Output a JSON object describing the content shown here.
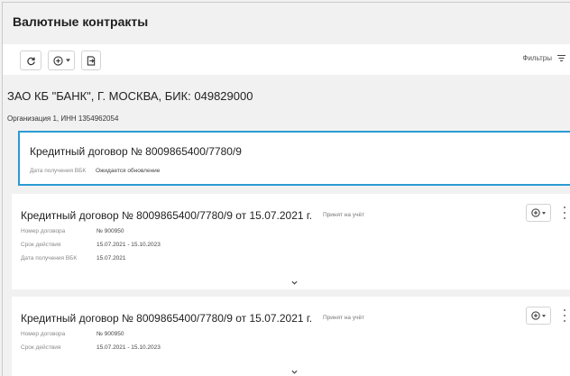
{
  "page": {
    "title": "Валютные контракты"
  },
  "toolbar": {
    "filters_label": "Фильтры"
  },
  "bank": {
    "title": "ЗАО КБ \"БАНК\", Г. МОСКВА, БИК: 049829000"
  },
  "organization": {
    "label": "Организация 1, ИНН 1354962054"
  },
  "cards": [
    {
      "title": "Кредитный договор № 8009865400/7780/9",
      "fields": [
        {
          "key": "Дата получения ВБК",
          "value": "Ожидается обновление"
        }
      ]
    },
    {
      "title": "Кредитный договор № 8009865400/7780/9 от 15.07.2021 г.",
      "status": "Принят на учёт",
      "fields": [
        {
          "key": "Номер договора",
          "value": "№ 900950"
        },
        {
          "key": "Срок действия",
          "value": "15.07.2021 - 15.10.2023"
        },
        {
          "key": "Дата получения ВБК",
          "value": "15.07.2021"
        }
      ]
    },
    {
      "title": "Кредитный договор № 8009865400/7780/9 от 15.07.2021 г.",
      "status": "Принят на учёт",
      "fields": [
        {
          "key": "Номер договора",
          "value": "№ 900950"
        },
        {
          "key": "Срок действия",
          "value": "15.07.2021 - 15.10.2023"
        }
      ]
    }
  ],
  "icons": {
    "refresh": "refresh-icon",
    "add": "plus-circle-icon",
    "export": "export-icon",
    "filter": "filter-icon",
    "more": "more-vertical-icon",
    "expand": "chevron-down-icon"
  },
  "colors": {
    "selected_border": "#2a9bd3",
    "background": "#f1f1f1"
  }
}
